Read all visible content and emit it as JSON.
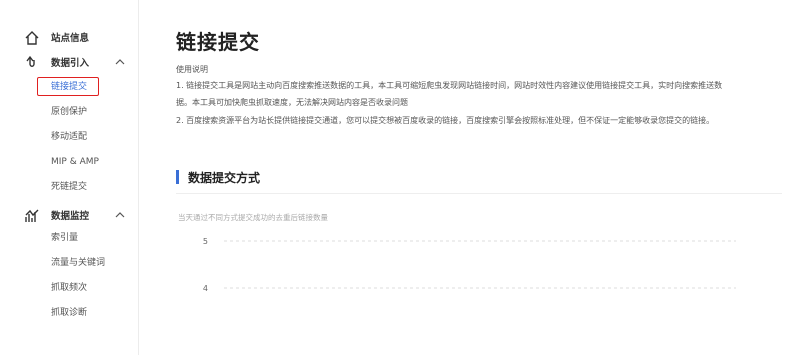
{
  "sidebar": {
    "site_info": {
      "label": "站点信息",
      "icon": "home-icon"
    },
    "data_import": {
      "label": "数据引入",
      "icon": "data-import-icon",
      "items": [
        {
          "label": "链接提交",
          "active": true
        },
        {
          "label": "原创保护"
        },
        {
          "label": "移动适配"
        },
        {
          "label": "MIP & AMP"
        },
        {
          "label": "死链提交"
        }
      ]
    },
    "data_monitor": {
      "label": "数据监控",
      "icon": "data-monitor-icon",
      "items": [
        {
          "label": "索引量"
        },
        {
          "label": "流量与关键词"
        },
        {
          "label": "抓取频次"
        },
        {
          "label": "抓取诊断"
        }
      ]
    }
  },
  "main": {
    "title": "链接提交",
    "usage_title": "使用说明",
    "desc_lines": [
      "1. 链接提交工具是网站主动向百度搜索推送数据的工具，本工具可缩短爬虫发现网站链接时间，网站时效性内容建议使用链接提交工具，实时向搜索推送数",
      "据。本工具可加快爬虫抓取速度，无法解决网站内容是否收录问题",
      "2. 百度搜索资源平台为站长提供链接提交通道，您可以提交想被百度收录的链接，百度搜索引擎会按照标准处理，但不保证一定能够收录您提交的链接。"
    ],
    "section_title": "数据提交方式"
  },
  "chart_data": {
    "type": "line",
    "title": "当天通过不同方式提交成功的去重后链接数量",
    "yticks": [
      5,
      4
    ],
    "grid": true,
    "series": []
  },
  "colors": {
    "accent": "#3a6fd6",
    "highlight_box": "#e02020"
  }
}
